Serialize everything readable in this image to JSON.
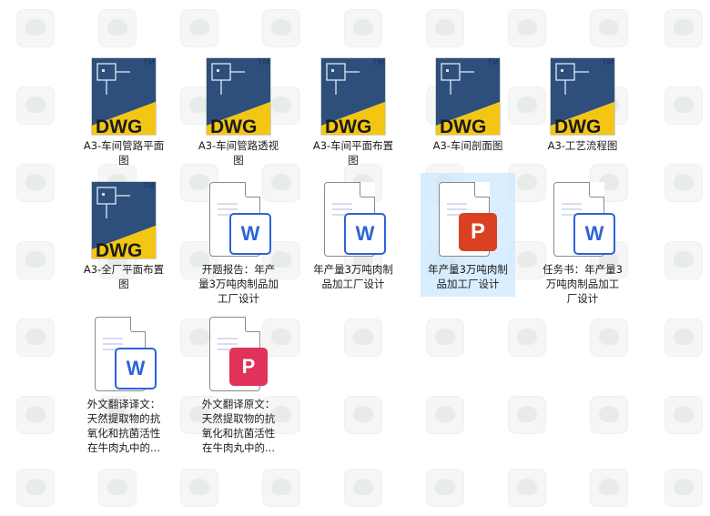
{
  "files": [
    {
      "name": "A3-车间管路平面图",
      "lines": [
        "A3-车间管路平面",
        "图"
      ],
      "type": "dwg",
      "type_label": "DWG",
      "tm": "TM"
    },
    {
      "name": "A3-车间管路透视图",
      "lines": [
        "A3-车间管路透视",
        "图"
      ],
      "type": "dwg",
      "type_label": "DWG",
      "tm": "TM"
    },
    {
      "name": "A3-车间平面布置图",
      "lines": [
        "A3-车间平面布置",
        "图"
      ],
      "type": "dwg",
      "type_label": "DWG",
      "tm": "TM"
    },
    {
      "name": "A3-车间剖面图",
      "lines": [
        "A3-车间剖面图"
      ],
      "type": "dwg",
      "type_label": "DWG",
      "tm": "TM"
    },
    {
      "name": "A3-工艺流程图",
      "lines": [
        "A3-工艺流程图"
      ],
      "type": "dwg",
      "type_label": "DWG",
      "tm": "TM"
    },
    {
      "name": "A3-全厂平面布置图",
      "lines": [
        "A3-全厂平面布置",
        "图"
      ],
      "type": "dwg",
      "type_label": "DWG",
      "tm": "TM"
    },
    {
      "name": "开题报告：年产量3万吨肉制品加工厂设计",
      "lines": [
        "开题报告：年产",
        "量3万吨肉制品加",
        "工厂设计"
      ],
      "type": "word",
      "type_label": "W"
    },
    {
      "name": "年产量3万吨肉制品加工厂设计",
      "lines": [
        "年产量3万吨肉制",
        "品加工厂设计"
      ],
      "type": "word",
      "type_label": "W"
    },
    {
      "name": "年产量3万吨肉制品加工厂设计",
      "lines": [
        "年产量3万吨肉制",
        "品加工厂设计"
      ],
      "type": "ppt",
      "type_label": "P",
      "selected": true
    },
    {
      "name": "任务书：年产量3万吨肉制品加工厂设计",
      "lines": [
        "任务书：年产量3",
        "万吨肉制品加工",
        "厂设计"
      ],
      "type": "word",
      "type_label": "W"
    },
    {
      "name": "外文翻译译文：天然提取物的抗氧化和抗菌活性在牛肉丸中的...",
      "lines": [
        "外文翻译译文：",
        "天然提取物的抗",
        "氧化和抗菌活性",
        "在牛肉丸中的..."
      ],
      "type": "word",
      "type_label": "W"
    },
    {
      "name": "外文翻译原文：天然提取物的抗氧化和抗菌活性在牛肉丸中的...",
      "lines": [
        "外文翻译原文：",
        "天然提取物的抗",
        "氧化和抗菌活性",
        "在牛肉丸中的..."
      ],
      "type": "pdf",
      "type_label": "P"
    }
  ]
}
